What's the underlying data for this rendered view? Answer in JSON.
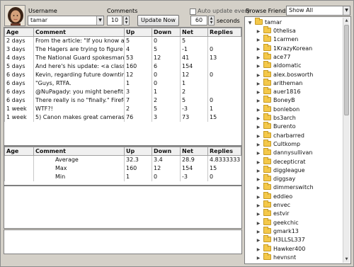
{
  "header": {
    "username_label": "Username",
    "username_value": "tamar",
    "comments_label": "Comments",
    "comments_value": "10",
    "update_button": "Update Now",
    "auto_update_label": "Auto update every",
    "seconds_value": "60",
    "seconds_label": "seconds"
  },
  "comments_table": {
    "columns": [
      "Age",
      "Comment",
      "Up",
      "Down",
      "Net",
      "Replies"
    ],
    "rows": [
      [
        "2 days",
        "From the article: \"If you know a resou",
        "5",
        "0",
        "5",
        ""
      ],
      [
        "3 days",
        "The Hagers are trying to figure out h",
        "4",
        "5",
        "-1",
        "0"
      ],
      [
        "4 days",
        "The National Guard spokesman say",
        "53",
        "12",
        "41",
        "13"
      ],
      [
        "5 days",
        "And here's his update: <a class=\"us",
        "160",
        "6",
        "154",
        ""
      ],
      [
        "6 days",
        "Kevin, regarding future downtime, tw",
        "12",
        "0",
        "12",
        "0"
      ],
      [
        "6 days",
        "\"Guys, RTFA.",
        "1",
        "0",
        "1",
        ""
      ],
      [
        "6 days",
        "@NuPagady: you might benefit from",
        "3",
        "1",
        "2",
        ""
      ],
      [
        "6 days",
        "There really is no \"finally.\"  Firefox alr",
        "7",
        "2",
        "5",
        "0"
      ],
      [
        "1 week",
        "WTF?!",
        "2",
        "5",
        "-3",
        "1"
      ],
      [
        "1 week",
        "5) Canon makes great cameras",
        "76",
        "3",
        "73",
        "15"
      ]
    ]
  },
  "stats_table": {
    "columns": [
      "Age",
      "Comment",
      "Up",
      "Down",
      "Net",
      "Replies"
    ],
    "rows": [
      [
        "",
        "Average",
        "32.3",
        "3.4",
        "28.9",
        "4.8333333"
      ],
      [
        "",
        "Max",
        "160",
        "12",
        "154",
        "15"
      ],
      [
        "",
        "Min",
        "1",
        "0",
        "-3",
        "0"
      ]
    ]
  },
  "browse": {
    "label": "Browse Friends:",
    "filter_value": "Show All",
    "root": "tamar",
    "friends": [
      "0thelisa",
      "1carmen",
      "1KrazyKorean",
      "ace77",
      "aldomatic",
      "alex.bosworth",
      "aritheman",
      "auer1816",
      "BoneyB",
      "bonlebon",
      "bs3arch",
      "Burento",
      "charbarred",
      "Cultkomp",
      "dannysullivan",
      "decepticrat",
      "diggleague",
      "diggsay",
      "dimmerswitch",
      "eddieo",
      "envec",
      "estvir",
      "geekchic",
      "gmark13",
      "H3LLSL337",
      "Hawker400",
      "hevnsnt"
    ]
  },
  "colors": {
    "window_bg": "#d4d0c8",
    "folder": "#f4c84a"
  }
}
